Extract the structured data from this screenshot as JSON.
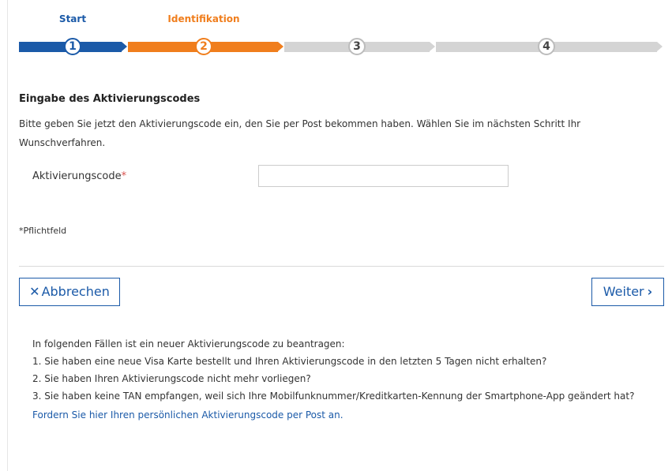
{
  "stepper": {
    "steps": [
      {
        "label": "Start",
        "number": "1",
        "state": "done",
        "color": "#1b5aa8"
      },
      {
        "label": "Identifikation",
        "number": "2",
        "state": "active",
        "color": "#f07e1d"
      },
      {
        "label": "",
        "number": "3",
        "state": "pending",
        "color": "#d4d4d4"
      },
      {
        "label": "",
        "number": "4",
        "state": "pending",
        "color": "#d4d4d4"
      }
    ]
  },
  "form": {
    "title": "Eingabe des Aktivierungscodes",
    "description": "Bitte geben Sie jetzt den Aktivierungscode ein, den Sie per Post bekommen haben. Wählen Sie im nächsten Schritt Ihr Wunschverfahren.",
    "field_label": "Aktivierungscode",
    "required_marker": "*",
    "field_value": "",
    "required_note": "*Pflichtfeld"
  },
  "buttons": {
    "cancel_label": "Abbrechen",
    "cancel_icon": "close-icon",
    "next_label": "Weiter",
    "next_icon": "chevron-right-icon"
  },
  "info": {
    "intro": "In folgenden Fällen ist ein neuer Aktivierungscode zu beantragen:",
    "items": [
      "1. Sie haben eine neue Visa Karte bestellt und Ihren Aktivierungscode in den letzten 5 Tagen nicht erhalten?",
      "2. Sie haben Ihren Aktivierungscode nicht mehr vorliegen?",
      "3. Sie haben keine TAN empfangen, weil sich Ihre Mobilfunknummer/Kreditkarten-Kennung der Smartphone-App geändert hat?"
    ],
    "link_text": "Fordern Sie hier Ihren persönlichen Aktivierungscode per Post an."
  },
  "colors": {
    "brand_blue": "#1b5aa8",
    "active_orange": "#f07e1d",
    "pending_grey": "#d4d4d4",
    "required_red": "#d9534f"
  }
}
